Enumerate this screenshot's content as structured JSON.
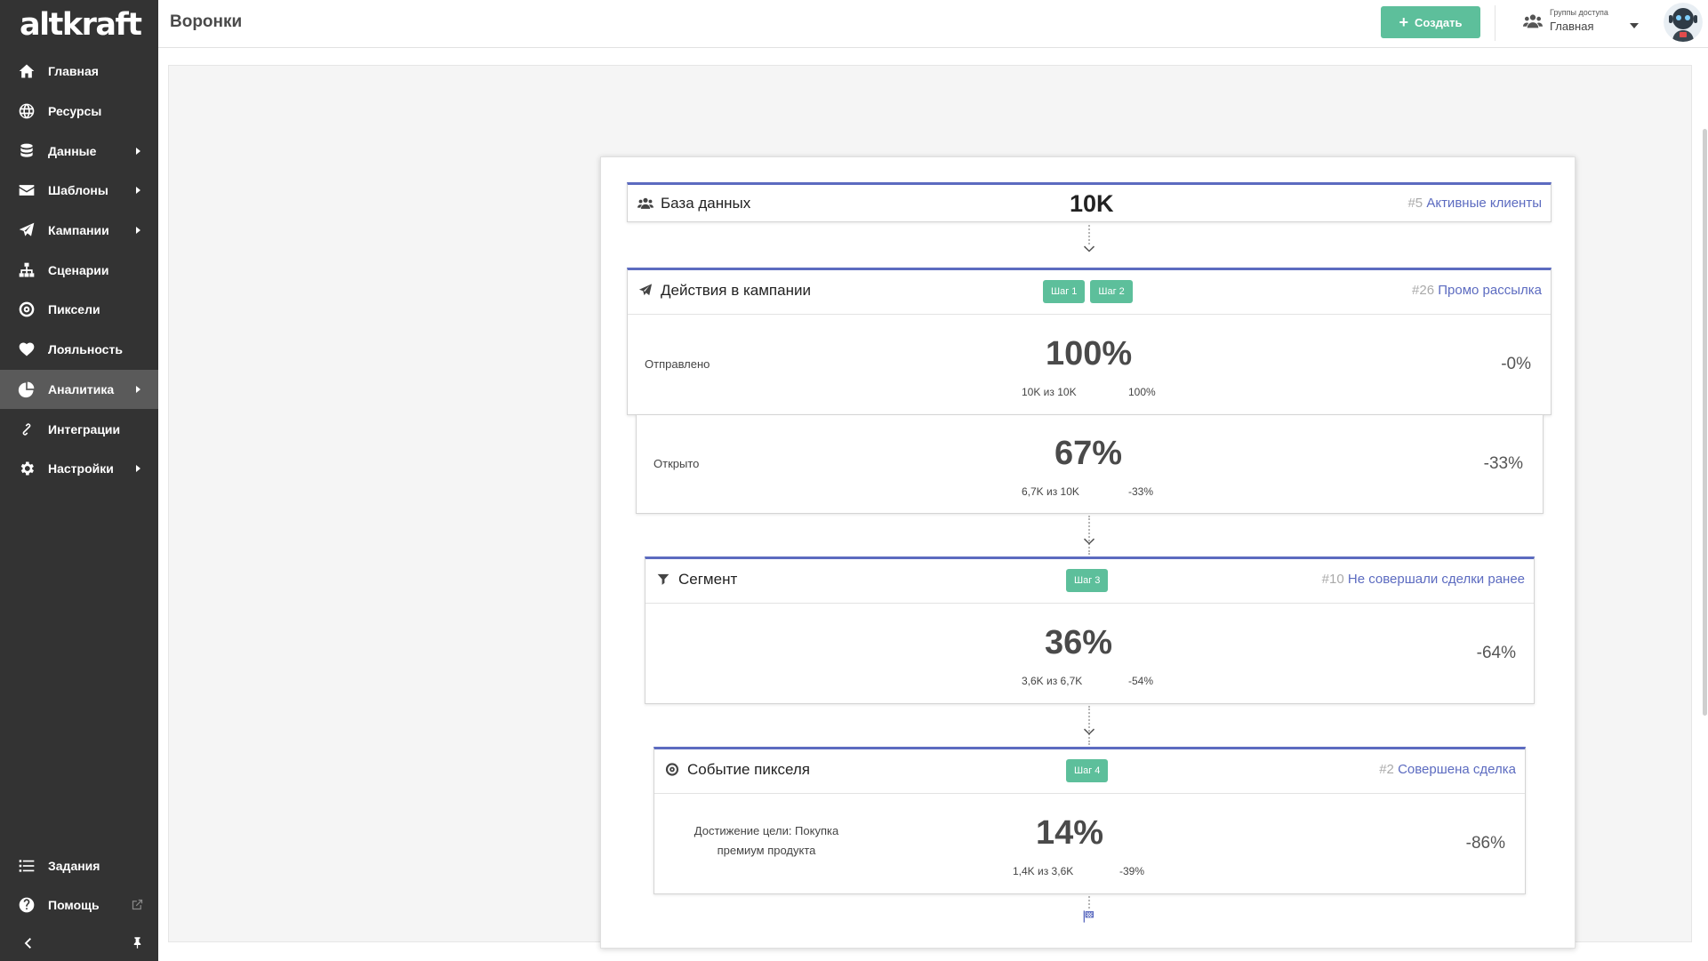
{
  "app": {
    "logo_text": "altkraft",
    "page_title": "Воронки"
  },
  "sidebar": {
    "items": [
      {
        "label": "Главная",
        "icon": "home-icon",
        "has_submenu": false
      },
      {
        "label": "Ресурсы",
        "icon": "globe-icon",
        "has_submenu": false
      },
      {
        "label": "Данные",
        "icon": "database-icon",
        "has_submenu": true
      },
      {
        "label": "Шаблоны",
        "icon": "envelope-icon",
        "has_submenu": true
      },
      {
        "label": "Кампании",
        "icon": "paper-plane-icon",
        "has_submenu": true
      },
      {
        "label": "Сценарии",
        "icon": "sitemap-icon",
        "has_submenu": false
      },
      {
        "label": "Пиксели",
        "icon": "target-icon",
        "has_submenu": false
      },
      {
        "label": "Лояльность",
        "icon": "heart-icon",
        "has_submenu": false
      },
      {
        "label": "Аналитика",
        "icon": "pie-chart-icon",
        "has_submenu": true,
        "active": true
      },
      {
        "label": "Интеграции",
        "icon": "link-icon",
        "has_submenu": false
      },
      {
        "label": "Настройки",
        "icon": "gear-icon",
        "has_submenu": true
      }
    ],
    "bottom_items": [
      {
        "label": "Задания",
        "icon": "list-icon"
      },
      {
        "label": "Помощь",
        "icon": "question-circle-icon"
      }
    ]
  },
  "header": {
    "create_label": "Создать",
    "access_group_label": "Группы доступа",
    "access_group_value": "Главная"
  },
  "funnel": {
    "database": {
      "title": "База данных",
      "total": "10K",
      "ref_num": "#5",
      "ref_name": "Активные клиенты"
    },
    "campaign": {
      "title": "Действия в кампании",
      "badges": [
        "Шаг 1",
        "Шаг 2"
      ],
      "ref_num": "#26",
      "ref_name": "Промо рассылка",
      "metrics": [
        {
          "label": "Отправлено",
          "value": "100%",
          "of": "10K из 10K",
          "step_delta": "100%",
          "total_delta": "-0%"
        },
        {
          "label": "Открыто",
          "value": "67%",
          "of": "6,7K из 10K",
          "step_delta": "-33%",
          "total_delta": "-33%"
        }
      ]
    },
    "segment": {
      "title": "Сегмент",
      "badges": [
        "Шаг 3"
      ],
      "ref_num": "#10",
      "ref_name": "Не совершали сделки ранее",
      "metric": {
        "label": "",
        "value": "36%",
        "of": "3,6K из 6,7K",
        "step_delta": "-54%",
        "total_delta": "-64%"
      }
    },
    "pixel": {
      "title": "Событие пикселя",
      "badges": [
        "Шаг 4"
      ],
      "ref_num": "#2",
      "ref_name": "Совершена сделка",
      "metric": {
        "label_line1": "Достижение цели: Покупка",
        "label_line2": "премиум продукта",
        "value": "14%",
        "of": "1,4K из 3,6K",
        "step_delta": "-39%",
        "total_delta": "-86%"
      }
    }
  },
  "colors": {
    "sidebar_bg": "#333333",
    "sidebar_active": "#5a5a5a",
    "accent_green": "#5dbf9b",
    "accent_blue": "#5c6bc0"
  }
}
